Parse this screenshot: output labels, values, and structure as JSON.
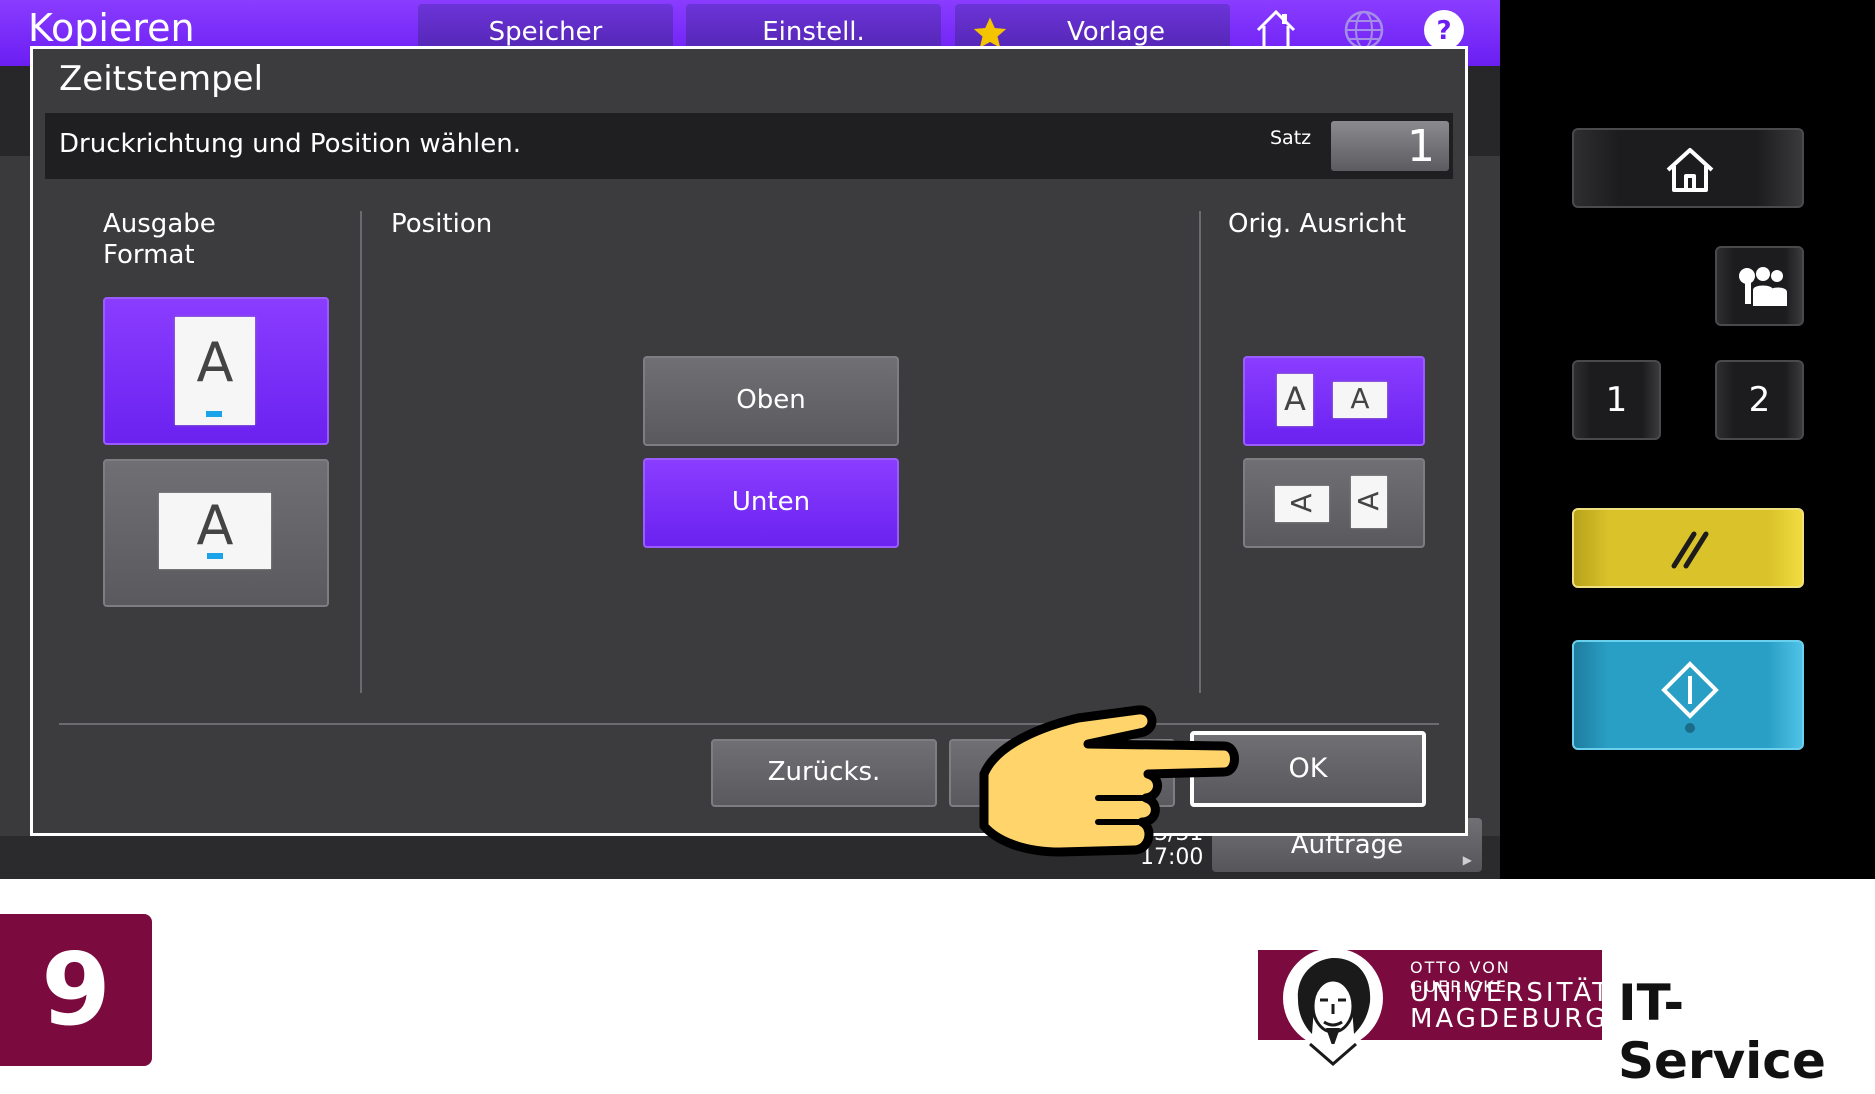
{
  "topbar": {
    "app_title": "Kopieren",
    "tabs": [
      "Speicher",
      "Einstell.",
      "Vorlage"
    ]
  },
  "dialog": {
    "title": "Zeitstempel",
    "instruction": "Druckrichtung und Position wählen.",
    "satz_label": "Satz",
    "satz_value": "1",
    "columns": {
      "output_format": "Ausgabe\nFormat",
      "position": "Position",
      "orientation": "Orig. Ausricht"
    },
    "output_format_glyph": "A",
    "position_options": [
      "Oben",
      "Unten"
    ],
    "orientation_glyphs": [
      "A",
      "A"
    ],
    "orientation_rot_glyphs": [
      "A",
      "A"
    ],
    "buttons": {
      "reset": "Zurücks.",
      "ok": "OK"
    }
  },
  "background": {
    "clock_date": "3/31",
    "clock_time": "17:00",
    "jobs": "Aufträge"
  },
  "hardware": {
    "num_1": "1",
    "num_2": "2"
  },
  "footer": {
    "step": "9",
    "logo_line1": "OTTO VON GUERICKE",
    "logo_line2": "UNIVERSITÄT",
    "logo_line3": "MAGDEBURG",
    "service": "IT-Service"
  },
  "colors": {
    "selected": "#7a2cff",
    "brand": "#7b0b3e",
    "reset_key": "#d9c22a",
    "start_key": "#2a9fc5"
  }
}
